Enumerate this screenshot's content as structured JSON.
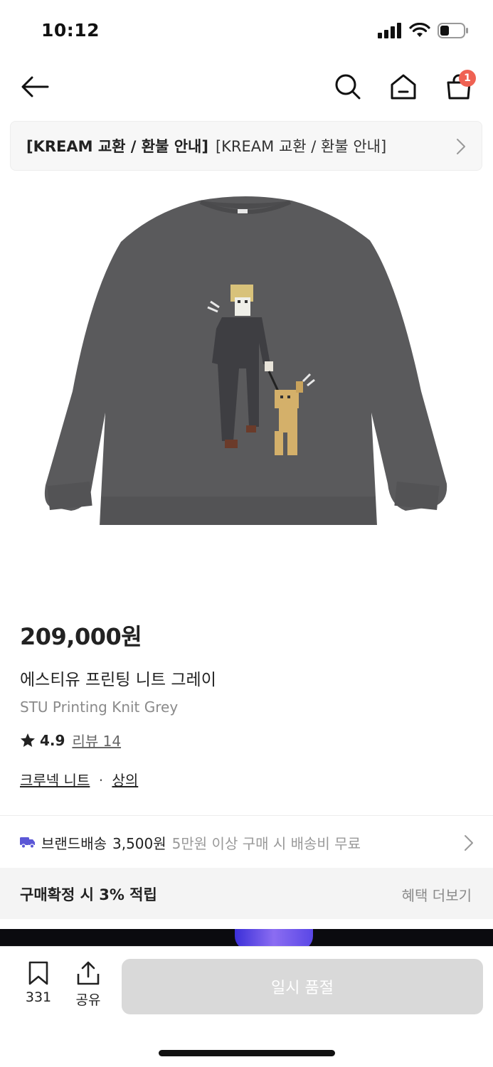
{
  "status_bar": {
    "time": "10:12"
  },
  "nav": {
    "cart_count": "1"
  },
  "notice": {
    "bold_text": "[KREAM 교환 / 환불 안내]",
    "text": "[KREAM 교환 / 환불 안내]"
  },
  "product": {
    "price": "209,000원",
    "name_ko": "에스티유 프린팅 니트 그레이",
    "name_en": "STU Printing Knit Grey",
    "rating": "4.9",
    "review_label": "리뷰 14",
    "category_1": "크루넥 니트",
    "category_sep": "·",
    "category_2": "상의"
  },
  "shipping": {
    "title": "브랜드배송",
    "price": "3,500원",
    "note": "5만원 이상 구매 시 배송비 무료"
  },
  "benefit": {
    "title": "구매확정 시 3% 적립",
    "more_label": "혜택 더보기"
  },
  "bottom_bar": {
    "bookmark_count": "331",
    "share_label": "공유",
    "soldout_label": "일시 품절"
  },
  "colors": {
    "badge": "#ef6253",
    "shipping_truck": "#5b57d6",
    "soldout_button": "#d9d9d9",
    "sweater": "#5a5a5c"
  },
  "icons": [
    "back-arrow-icon",
    "search-icon",
    "home-icon",
    "cart-icon",
    "chevron-right-icon",
    "star-icon",
    "truck-icon",
    "bookmark-icon",
    "share-icon"
  ]
}
